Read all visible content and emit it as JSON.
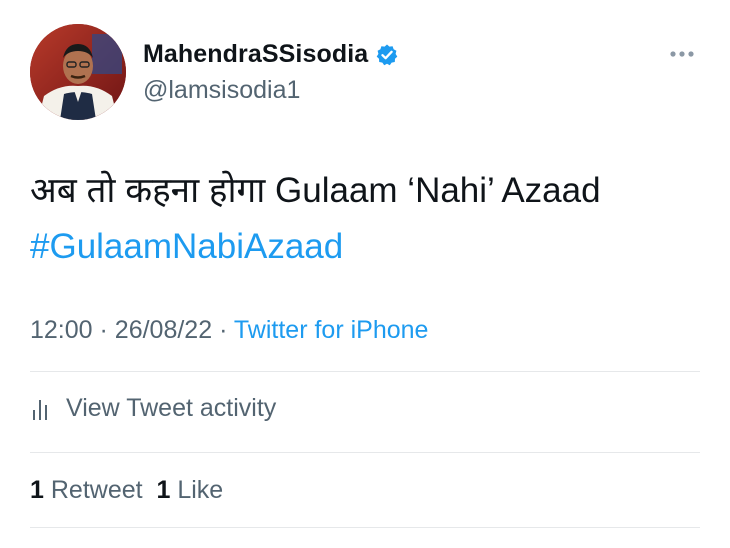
{
  "author": {
    "display_name": "MahendraSSisodia",
    "handle": "@lamsisodia1",
    "verified": true,
    "avatar_icon": "profile-photo"
  },
  "more_icon": "ellipsis-icon",
  "tweet": {
    "text_plain": "अब तो कहना होगा Gulaam ‘Nahi’ Azaad",
    "hashtag": "#GulaamNabiAzaad"
  },
  "meta": {
    "time": "12:00",
    "separator": "·",
    "date": "26/08/22",
    "source": "Twitter for iPhone"
  },
  "activity": {
    "label": "View Tweet activity",
    "icon": "bar-chart-icon"
  },
  "stats": {
    "retweet_count": "1",
    "retweet_label": "Retweet",
    "like_count": "1",
    "like_label": "Like"
  },
  "colors": {
    "accent": "#1d9bf0",
    "text_primary": "#0f1419",
    "text_secondary": "#536471",
    "divider": "#e6e8ea"
  }
}
